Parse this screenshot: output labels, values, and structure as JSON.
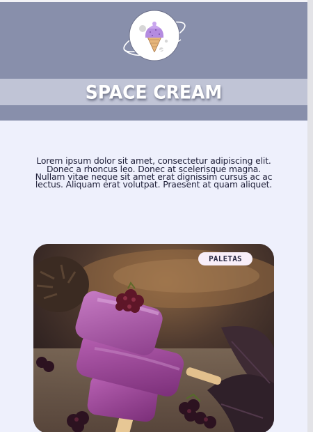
{
  "brand": {
    "title": "SPACE CREAM",
    "logo_icon": "ice-cream-planet-icon"
  },
  "intro": {
    "text": "Lorem ipsum dolor sit amet, consectetur adipiscing elit. Donec a rhoncus leo. Donec at scelerisque magna. Nullam vitae neque sit amet erat dignissim cursus ac ac lectus. Aliquam erat volutpat. Praesent at quam aliquet."
  },
  "card": {
    "badge_label": "PALETAS",
    "image_subject": "purple-popsicles-with-blackberries"
  },
  "colors": {
    "header_bg": "#888fab",
    "title_band_bg": "#c0c4d6",
    "page_bg": "#eef0fc",
    "text_dark": "#1e1f38",
    "badge_bg": "#f8eef8"
  }
}
